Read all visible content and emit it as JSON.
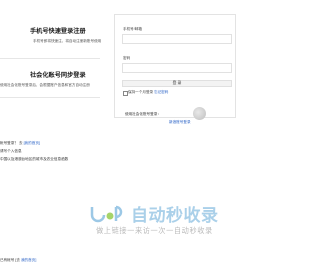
{
  "left": {
    "phone_section": {
      "title": "手机号快速登录注册",
      "subtitle": "手机号即将快速注，将自动注册新账号使用"
    },
    "social_section": {
      "title": "社会化账号同步登录",
      "subtitle": "使用社会化账号登录后，会根据账户信息和官方自动注册"
    }
  },
  "login_panel": {
    "username_label": "手机号/邮箱",
    "password_label": "密码",
    "login_button": "登 录",
    "remember_label": "保持一个月登录",
    "forgot_link": "忘记密码",
    "social_hint": "使用社会化账号登录：",
    "social_link": "新浪账号登录"
  },
  "lower_left": {
    "line1_text": "帐号登录？ 去",
    "line1_link": "[我的首页]",
    "line2": "请写个入信息",
    "line3": "中国以及港澳台地区的城市及农业信息函数"
  },
  "bottom_left": {
    "text": "已有帐号 [去",
    "link": "我的首页]"
  },
  "watermark": {
    "brand": "自动秒收录",
    "tagline": "做上链接一来访一次一自动秒收录"
  },
  "colors": {
    "accent_blue": "#2b63c6",
    "watermark_blue": "#6aa9df",
    "watermark_green": "#8ccb4a"
  }
}
